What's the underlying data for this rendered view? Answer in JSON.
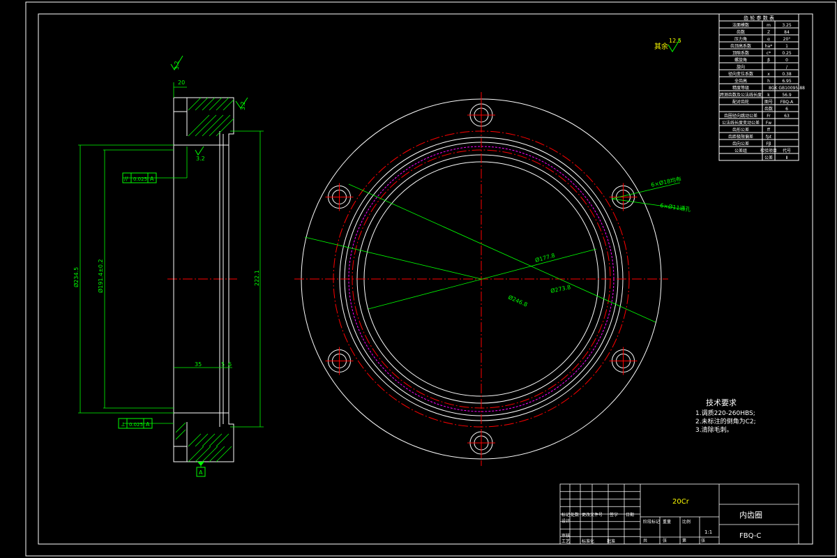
{
  "colors": {
    "background": "#000000",
    "outline": "#ffffff",
    "dimension": "#00ff00",
    "centerline": "#ff0000",
    "pitch": "#ff00ff",
    "label": "#ffff00"
  },
  "roughness": {
    "label": "其余",
    "value": "12.5"
  },
  "side_view": {
    "width_top": "20",
    "roughness_top": "3.2",
    "roughness_right": "3.2",
    "roughness_bore": "3.2",
    "dia_left": "Ø234.5",
    "dia_inner": "Ø191.4±0.2",
    "dia_right": "222.1",
    "dim_bottom_left": "35",
    "dim_bottom_mid": "5",
    "dim_bottom_right": "6",
    "gtol_top_sym": "//",
    "gtol_top_value": "0.025",
    "gtol_top_ref": "A",
    "gtol_bottom_sym": "⊥",
    "gtol_bottom_value": "0.025",
    "gtol_bottom_ref": "A",
    "datum": "A"
  },
  "front_view": {
    "dia_1": "Ø177.8",
    "dia_2": "Ø273.8",
    "dia_3": "Ø246.8",
    "hole_note_1": "6×Ø18均布",
    "hole_note_2": "6×Ø11通孔"
  },
  "param_table": {
    "header": "齿 轮 参 数 表",
    "rows": [
      [
        "法面模数",
        "m",
        "3.25"
      ],
      [
        "齿数",
        "Z",
        "84"
      ],
      [
        "压力角",
        "α",
        "20°"
      ],
      [
        "齿顶高系数",
        "ha*",
        "1"
      ],
      [
        "顶隙系数",
        "c*",
        "0.25"
      ],
      [
        "螺旋角",
        "β",
        "0"
      ],
      [
        "旋向",
        "",
        "/"
      ],
      [
        "径向变位系数",
        "x",
        "0.38"
      ],
      [
        "全齿高",
        "h",
        "6.95"
      ],
      [
        "精度等级",
        "",
        "8GK GB10095-88"
      ],
      [
        "跨测齿数及公法线长度",
        "k",
        "56.9"
      ],
      [
        "配对齿轮",
        "图号",
        "FBQ-A"
      ],
      [
        "",
        "齿数",
        "6"
      ],
      [
        "齿圈径向跳动公差",
        "Fr",
        "63"
      ],
      [
        "公法线长度变动公差",
        "Fw",
        ""
      ],
      [
        "齿形公差",
        "ff",
        ""
      ],
      [
        "齿距极限偏差",
        "fpt",
        ""
      ],
      [
        "齿向公差",
        "Fβ",
        ""
      ],
      [
        "公差组",
        "检验项目",
        "代号"
      ],
      [
        "",
        "公差",
        "Ⅱ"
      ]
    ]
  },
  "tech_req": {
    "title": "技术要求",
    "items": [
      "1.调质220-260HBS;",
      "2.未标注的倒角为C2;",
      "3.清除毛刺。"
    ]
  },
  "title_block": {
    "material": "20Cr",
    "part_name": "内齿圈",
    "drawing_no": "FBQ-C",
    "scale": "1:1",
    "cells": [
      "标记",
      "处数",
      "更改文件号",
      "签字",
      "日期",
      "设计",
      "审核",
      "阶段标记",
      "重量",
      "比例",
      "共",
      "张",
      "第",
      "张",
      "工艺",
      "标准化",
      "批准"
    ]
  }
}
